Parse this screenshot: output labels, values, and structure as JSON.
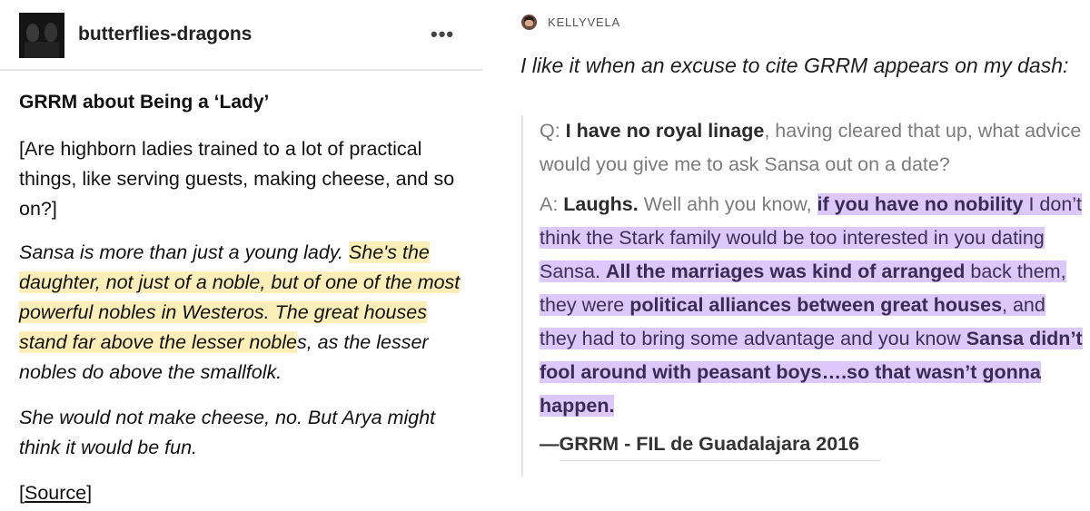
{
  "left_post": {
    "username": "butterflies-dragons",
    "more_label": "•••",
    "title": "GRRM about Being a ‘Lady’",
    "question": "[Are highborn ladies trained to a lot of practical things, like serving guests, making cheese, and so on?]",
    "answer_plain": "Sansa is more than just a young lady. ",
    "answer_highlight": "She's the daughter, not just of a noble, but of one of the most powerful nobles in Westeros. The great houses stand far above the lesser noble",
    "answer_rest": "s, as the lesser nobles do above the smallfolk.",
    "answer2": "She would not make cheese, no. But Arya might think it would be fun.",
    "source_open": "[",
    "source_link": "Source",
    "source_close": "]",
    "highlight_color": "#fbeeb8"
  },
  "right_post": {
    "username": "KELLYVELA",
    "intro": "I like it when an excuse to cite GRRM appears on my dash:",
    "q_prefix": "Q: ",
    "q_bold": "I have no royal linage",
    "q_rest": ", having cleared that up, what advice would you give me to ask Sansa out on a date?",
    "a_prefix": "A: ",
    "a_bold": "Laughs.",
    "a_text1": " Well ahh you know, ",
    "a_hl1_bold": "if you have no nobility",
    "a_hl1_rest": " I don’t think the Stark family would be too interested in you dating Sansa. ",
    "a_hl2_bold": "All the marriages was kind of arranged",
    "a_hl2_rest": " back them, they were ",
    "a_hl3_bold": "political alliances between great houses",
    "a_hl3_rest": ", and they had to bring some advantage and you know ",
    "a_hl4_bold": "Sansa didn’t fool around with peasant boys….so that wasn’t gonna happen.",
    "citation": "—GRRM - FIL de Guadalajara 2016",
    "highlight_color": "#dcc8fa"
  }
}
